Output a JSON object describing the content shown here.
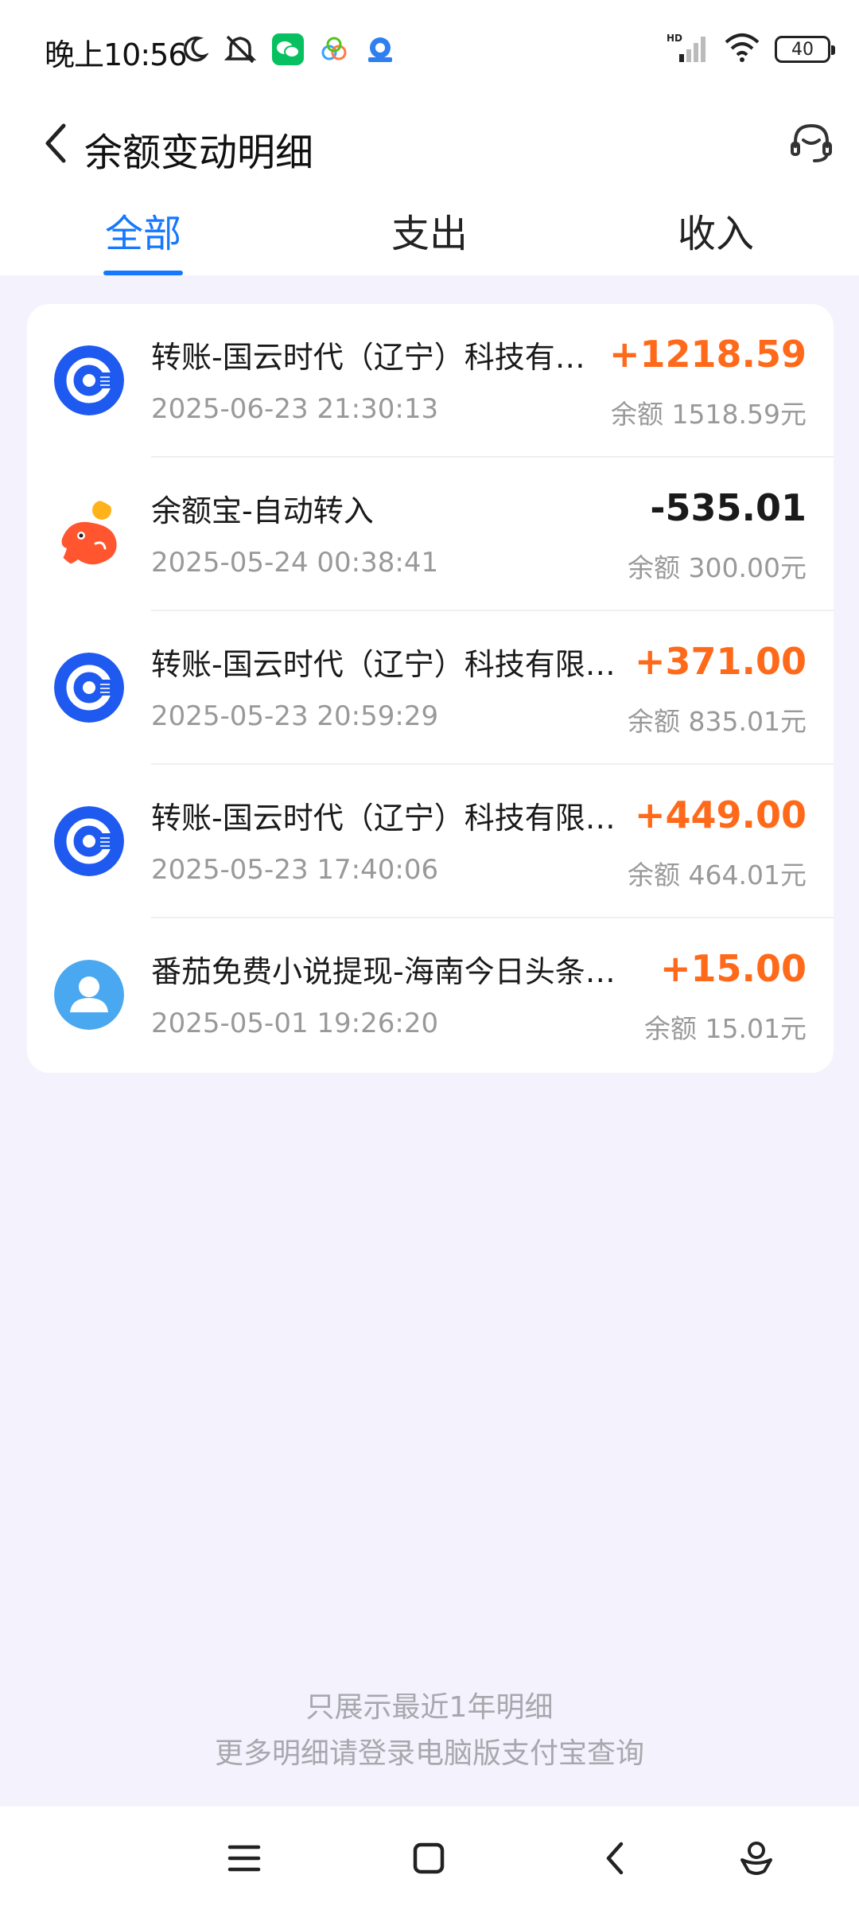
{
  "status": {
    "time": "晚上10:56",
    "hd": "HD",
    "battery": "40",
    "icons": [
      "moon-icon",
      "mute-icon",
      "wechat-icon",
      "app-icon",
      "app-icon-2",
      "signal-icon",
      "wifi-icon",
      "battery-icon"
    ]
  },
  "header": {
    "title": "余额变动明细"
  },
  "tabs": [
    {
      "label": "全部",
      "active": true
    },
    {
      "label": "支出",
      "active": false
    },
    {
      "label": "收入",
      "active": false
    }
  ],
  "transactions": [
    {
      "title": "转账-国云时代（辽宁）科技有…",
      "amount": "+1218.59",
      "datetime": "2025-06-23 21:30:13",
      "balance": "余额 1518.59元",
      "icon": "transfer-logo-icon",
      "type": "income"
    },
    {
      "title": "余额宝-自动转入",
      "amount": "-535.01",
      "datetime": "2025-05-24 00:38:41",
      "balance": "余额 300.00元",
      "icon": "yuebao-logo-icon",
      "type": "expense"
    },
    {
      "title": "转账-国云时代（辽宁）科技有限…",
      "amount": "+371.00",
      "datetime": "2025-05-23 20:59:29",
      "balance": "余额 835.01元",
      "icon": "transfer-logo-icon",
      "type": "income"
    },
    {
      "title": "转账-国云时代（辽宁）科技有限…",
      "amount": "+449.00",
      "datetime": "2025-05-23 17:40:06",
      "balance": "余额 464.01元",
      "icon": "transfer-logo-icon",
      "type": "income"
    },
    {
      "title": "番茄免费小说提现-海南今日头条…",
      "amount": "+15.00",
      "datetime": "2025-05-01 19:26:20",
      "balance": "余额 15.01元",
      "icon": "user-avatar-icon",
      "type": "income"
    }
  ],
  "footer": {
    "line1": "只展示最近1年明细",
    "line2": "更多明细请登录电脑版支付宝查询"
  },
  "colors": {
    "accent": "#1677ff",
    "income": "#ff6a1a",
    "background": "#f4f3fd"
  }
}
